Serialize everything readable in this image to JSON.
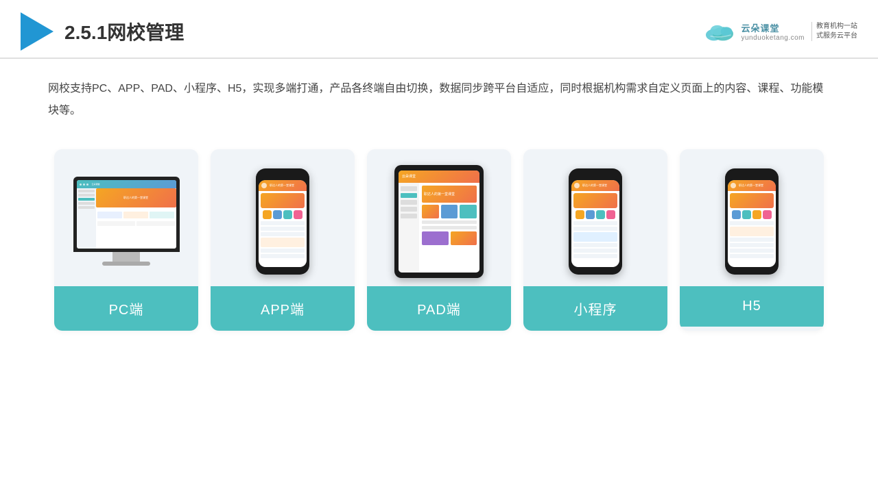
{
  "header": {
    "title": "2.5.1网校管理",
    "brand": {
      "name": "云朵课堂",
      "url": "yunduoketang.com",
      "tagline": "教育机构一站\n式服务云平台"
    }
  },
  "description": "网校支持PC、APP、PAD、小程序、H5，实现多端打通，产品各终端自由切换，数据同步跨平台自适应，同时根据机构需求自定义页面上的内容、课程、功能模块等。",
  "cards": [
    {
      "id": "pc",
      "label": "PC端"
    },
    {
      "id": "app",
      "label": "APP端"
    },
    {
      "id": "pad",
      "label": "PAD端"
    },
    {
      "id": "miniprogram",
      "label": "小程序"
    },
    {
      "id": "h5",
      "label": "H5"
    }
  ],
  "colors": {
    "accent": "#4dbfbf",
    "header_border": "#e0e0e0",
    "card_bg": "#f0f4f8",
    "triangle": "#2196d3"
  }
}
